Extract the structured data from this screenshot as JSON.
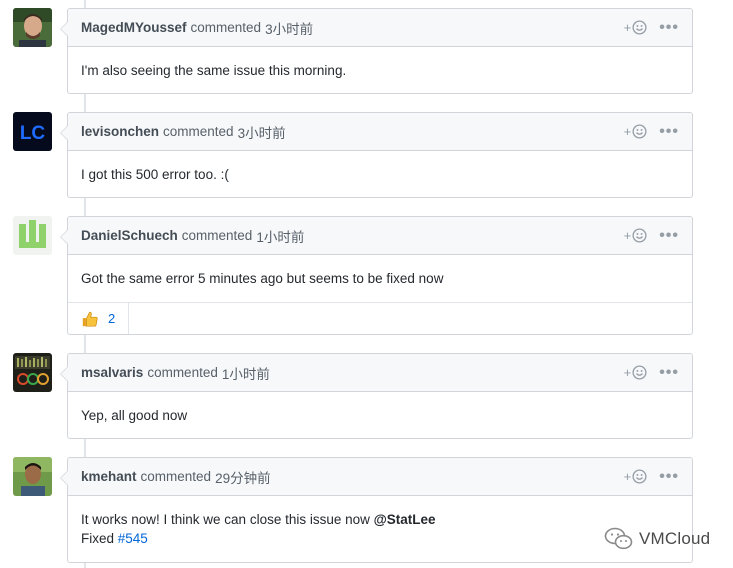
{
  "comments": [
    {
      "author": "MagedMYoussef",
      "verb": "commented",
      "time": "3小时前",
      "body": "I'm also seeing the same issue this morning."
    },
    {
      "author": "levisonchen",
      "verb": "commented",
      "time": "3小时前",
      "body": "I got this 500 error too. :("
    },
    {
      "author": "DanielSchuech",
      "verb": "commented",
      "time": "1小时前",
      "body": "Got the same error 5 minutes ago but seems to be fixed now",
      "reaction": {
        "icon": "thumbs-up-icon",
        "count": "2"
      }
    },
    {
      "author": "msalvaris",
      "verb": "commented",
      "time": "1小时前",
      "body": "Yep, all good now"
    },
    {
      "author": "kmehant",
      "verb": "commented",
      "time": "29分钟前",
      "body_line1": "It works now! I think we can close this issue now ",
      "mention": "@StatLee",
      "body_line2_prefix": "Fixed ",
      "issue_ref": "#545"
    }
  ],
  "actions": {
    "add_reaction_plus": "+",
    "kebab": "•••"
  },
  "avatars": {
    "levisonchen_initials": "LC"
  },
  "watermark": {
    "text": "VMCloud"
  },
  "colors": {
    "accent_link": "#0366d6",
    "header_bg": "#f6f8fa",
    "border": "#d1d5da"
  }
}
